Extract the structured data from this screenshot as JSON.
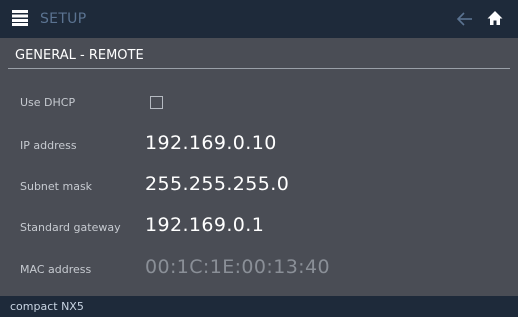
{
  "header": {
    "title": "SETUP",
    "menu_icon": "hamburger-icon",
    "back_icon": "arrow-left-icon",
    "home_icon": "home-icon"
  },
  "section": {
    "title": "GENERAL - REMOTE"
  },
  "settings": {
    "use_dhcp": {
      "label": "Use DHCP",
      "checked": false
    },
    "ip_address": {
      "label": "IP address",
      "value": "192.169.0.10"
    },
    "subnet_mask": {
      "label": "Subnet mask",
      "value": "255.255.255.0"
    },
    "standard_gateway": {
      "label": "Standard gateway",
      "value": "192.169.0.1"
    },
    "mac_address": {
      "label": "MAC address",
      "value": "00:1C:1E:00:13:40"
    }
  },
  "footer": {
    "device_name": "compact NX5"
  },
  "colors": {
    "bar_background": "#1e2a3a",
    "screen_background": "#4a4d55",
    "title_accent": "#5b7391",
    "disabled_value": "#8a8f97"
  }
}
